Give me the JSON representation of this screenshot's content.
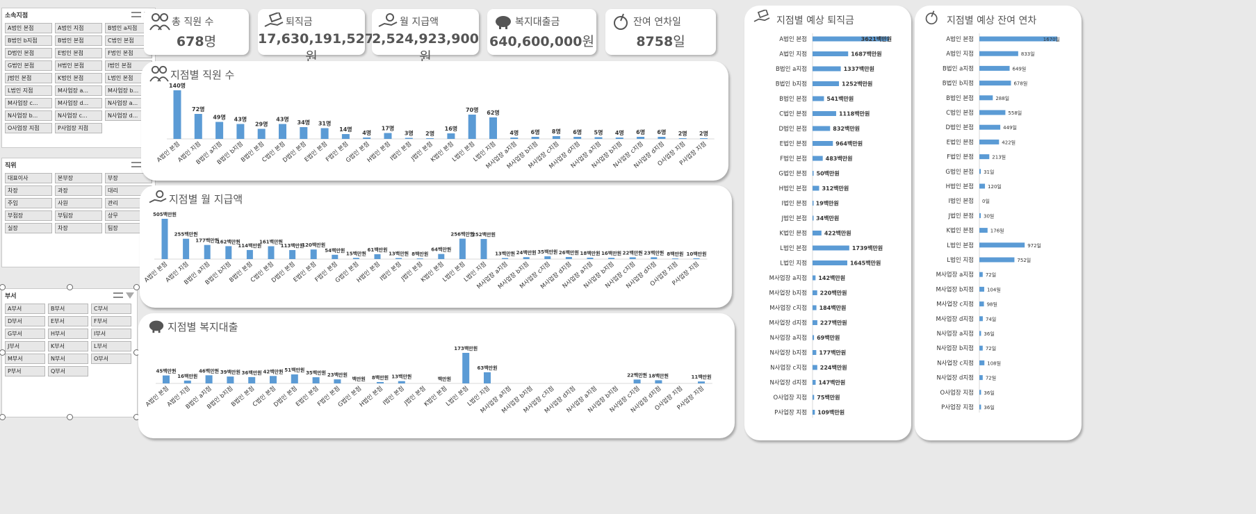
{
  "slicers": [
    {
      "title": "소속지점",
      "items": [
        "A법인 본점",
        "A법인 지점",
        "B법인 a지점",
        "B법인 b지점",
        "B법인 본점",
        "C법인 본점",
        "D법인 본점",
        "E법인 본점",
        "F법인 본점",
        "G법인 본점",
        "H법인 본점",
        "I법인 본점",
        "J법인 본점",
        "K법인 본점",
        "L법인 본점",
        "L법인 지점",
        "M사업장 a...",
        "M사업장 b...",
        "M사업장 c...",
        "M사업장 d...",
        "N사업장 a...",
        "N사업장 b...",
        "N사업장 c...",
        "N사업장 d...",
        "O사업장 지점",
        "P사업장 지점"
      ]
    },
    {
      "title": "직위",
      "items": [
        "대표이사",
        "본부장",
        "부장",
        "차장",
        "과장",
        "대리",
        "주임",
        "사원",
        "관리",
        "부점장",
        "부팀장",
        "상무",
        "실장",
        "차장",
        "팀장"
      ]
    },
    {
      "title": "부서",
      "items": [
        "A부서",
        "B부서",
        "C부서",
        "D부서",
        "E부서",
        "F부서",
        "G부서",
        "H부서",
        "I부서",
        "J부서",
        "K부서",
        "L부서",
        "M부서",
        "N부서",
        "O부서",
        "P부서",
        "Q부서"
      ]
    }
  ],
  "kpis": [
    {
      "label": "총 직원 수",
      "value": "678",
      "unit": "명",
      "icon": "people-icon"
    },
    {
      "label": "퇴직금",
      "value": "17,630,191,527",
      "unit": "원",
      "icon": "hand-money-icon"
    },
    {
      "label": "월 지급액",
      "value": "2,524,923,900",
      "unit": "원",
      "icon": "hand-coin-icon"
    },
    {
      "label": "복지대출금",
      "value": "640,600,000",
      "unit": "원",
      "icon": "piggy-bank-icon"
    },
    {
      "label": "잔여 연차일",
      "value": "8758",
      "unit": "일",
      "icon": "coconut-drink-icon"
    }
  ],
  "colors": {
    "bar": "#5b9bd5",
    "panel": "#ffffff",
    "bg": "#e9e9e9"
  },
  "chart_data": [
    {
      "type": "bar",
      "title": "지점별 직원 수",
      "unit": "명",
      "categories": [
        "A법인 본점",
        "A법인 지점",
        "B법인 a지점",
        "B법인 b지점",
        "B법인 본점",
        "C법인 본점",
        "D법인 본점",
        "E법인 본점",
        "F법인 본점",
        "G법인 본점",
        "H법인 본점",
        "I법인 본점",
        "J법인 본점",
        "K법인 본점",
        "L법인 본점",
        "L법인 지점",
        "M사업장 a지점",
        "M사업장 b지점",
        "M사업장 c지점",
        "M사업장 d지점",
        "N사업장 a지점",
        "N사업장 b지점",
        "N사업장 c지점",
        "N사업장 d지점",
        "O사업장 지점",
        "P사업장 지점"
      ],
      "values": [
        140,
        72,
        49,
        43,
        29,
        43,
        34,
        31,
        14,
        4,
        17,
        3,
        2,
        16,
        70,
        62,
        4,
        6,
        8,
        6,
        5,
        4,
        6,
        6,
        2,
        2
      ],
      "labels": [
        "140명",
        "72명",
        "49명",
        "43명",
        "29명",
        "43명",
        "34명",
        "31명",
        "14명",
        "4명",
        "17명",
        "3명",
        "2명",
        "16명",
        "70명",
        "62명",
        "4명",
        "6명",
        "8명",
        "6명",
        "5명",
        "4명",
        "6명",
        "6명",
        "2명",
        "2명"
      ]
    },
    {
      "type": "bar",
      "title": "지점별 월 지급액",
      "unit": "백만원",
      "categories": [
        "A법인 본점",
        "A법인 지점",
        "B법인 a지점",
        "B법인 b지점",
        "B법인 본점",
        "C법인 본점",
        "D법인 본점",
        "E법인 본점",
        "F법인 본점",
        "G법인 본점",
        "H법인 본점",
        "I법인 본점",
        "J법인 본점",
        "K법인 본점",
        "L법인 본점",
        "L법인 지점",
        "M사업장 a지점",
        "M사업장 b지점",
        "M사업장 c지점",
        "M사업장 d지점",
        "N사업장 a지점",
        "N사업장 b지점",
        "N사업장 c지점",
        "N사업장 d지점",
        "O사업장 지점",
        "P사업장 지점"
      ],
      "values": [
        505,
        255,
        177,
        162,
        114,
        161,
        113,
        120,
        54,
        15,
        61,
        13,
        8,
        64,
        256,
        252,
        13,
        24,
        35,
        26,
        18,
        16,
        22,
        23,
        8,
        10
      ],
      "labels": [
        "505백만원",
        "255백만원",
        "177백만원",
        "162백만원",
        "114백만원",
        "161백만원",
        "113백만원",
        "120백만원",
        "54백만원",
        "15백만원",
        "61백만원",
        "13백만원",
        "8백만원",
        "64백만원",
        "256백만원",
        "252백만원",
        "13백만원",
        "24백만원",
        "35백만원",
        "26백만원",
        "18백만원",
        "16백만원",
        "22백만원",
        "23백만원",
        "8백만원",
        "10백만원"
      ]
    },
    {
      "type": "bar",
      "title": "지점별 복지대출",
      "unit": "백만원",
      "categories": [
        "A법인 본점",
        "A법인 지점",
        "B법인 a지점",
        "B법인 b지점",
        "B법인 본점",
        "C법인 본점",
        "D법인 본점",
        "E법인 본점",
        "F법인 본점",
        "G법인 본점",
        "H법인 본점",
        "I법인 본점",
        "J법인 본점",
        "K법인 본점",
        "L법인 본점",
        "L법인 지점",
        "M사업장 a지점",
        "M사업장 b지점",
        "M사업장 c지점",
        "M사업장 d지점",
        "N사업장 a지점",
        "N사업장 b지점",
        "N사업장 c지점",
        "N사업장 d지점",
        "O사업장 지점",
        "P사업장 지점"
      ],
      "values": [
        45,
        16,
        46,
        39,
        36,
        42,
        51,
        35,
        23,
        0,
        8,
        13,
        0,
        0,
        173,
        63,
        0,
        0,
        0,
        0,
        0,
        0,
        22,
        18,
        0,
        11
      ],
      "labels": [
        "45백만원",
        "16백만원",
        "46백만원",
        "39백만원",
        "36백만원",
        "42백만원",
        "51백만원",
        "35백만원",
        "23백만원",
        "백만원",
        "8백만원",
        "13백만원",
        "",
        "백만원",
        "173백만원",
        "63백만원",
        "",
        "",
        "",
        "",
        "",
        "",
        "22백만원",
        "18백만원",
        "",
        "11백만원"
      ]
    },
    {
      "type": "bar",
      "orientation": "horizontal",
      "title": "지점별 예상 퇴직금",
      "unit": "백만원",
      "categories": [
        "A법인 본점",
        "A법인 지점",
        "B법인 a지점",
        "B법인 b지점",
        "B법인 본점",
        "C법인 본점",
        "D법인 본점",
        "E법인 본점",
        "F법인 본점",
        "G법인 본점",
        "H법인 본점",
        "I법인 본점",
        "J법인 본점",
        "K법인 본점",
        "L법인 본점",
        "L법인 지점",
        "M사업장 a지점",
        "M사업장 b지점",
        "M사업장 c지점",
        "M사업장 d지점",
        "N사업장 a지점",
        "N사업장 b지점",
        "N사업장 c지점",
        "N사업장 d지점",
        "O사업장 지점",
        "P사업장 지점"
      ],
      "values": [
        3621,
        1687,
        1337,
        1252,
        541,
        1118,
        832,
        964,
        483,
        50,
        312,
        19,
        34,
        422,
        1739,
        1645,
        142,
        220,
        184,
        227,
        69,
        177,
        224,
        147,
        75,
        109
      ],
      "labels": [
        "3621백만원",
        "1687백만원",
        "1337백만원",
        "1252백만원",
        "541백만원",
        "1118백만원",
        "832백만원",
        "964백만원",
        "483백만원",
        "50백만원",
        "312백만원",
        "19백만원",
        "34백만원",
        "422백만원",
        "1739백만원",
        "1645백만원",
        "142백만원",
        "220백만원",
        "184백만원",
        "227백만원",
        "69백만원",
        "177백만원",
        "224백만원",
        "147백만원",
        "75백만원",
        "109백만원"
      ]
    },
    {
      "type": "bar",
      "orientation": "horizontal",
      "title": "지점별 예상 잔여 연차",
      "unit": "일",
      "categories": [
        "A법인 본점",
        "A법인 지점",
        "B법인 a지점",
        "B법인 b지점",
        "B법인 본점",
        "C법인 본점",
        "D법인 본점",
        "E법인 본점",
        "F법인 본점",
        "G법인 본점",
        "H법인 본점",
        "I법인 본점",
        "J법인 본점",
        "K법인 본점",
        "L법인 본점",
        "L법인 지점",
        "M사업장 a지점",
        "M사업장 b지점",
        "M사업장 c지점",
        "M사업장 d지점",
        "N사업장 a지점",
        "N사업장 b지점",
        "N사업장 c지점",
        "N사업장 d지점",
        "O사업장 지점",
        "P사업장 지점"
      ],
      "values": [
        1670,
        833,
        649,
        678,
        288,
        558,
        449,
        422,
        213,
        31,
        120,
        0,
        30,
        176,
        972,
        752,
        72,
        104,
        98,
        74,
        36,
        72,
        108,
        72,
        36,
        36
      ],
      "labels": [
        "1670일",
        "833일",
        "649일",
        "678일",
        "288일",
        "558일",
        "449일",
        "422일",
        "213일",
        "31일",
        "120일",
        "0일",
        "30일",
        "176일",
        "972일",
        "752일",
        "72일",
        "104일",
        "98일",
        "74일",
        "36일",
        "72일",
        "108일",
        "72일",
        "36일",
        "36일"
      ]
    }
  ]
}
